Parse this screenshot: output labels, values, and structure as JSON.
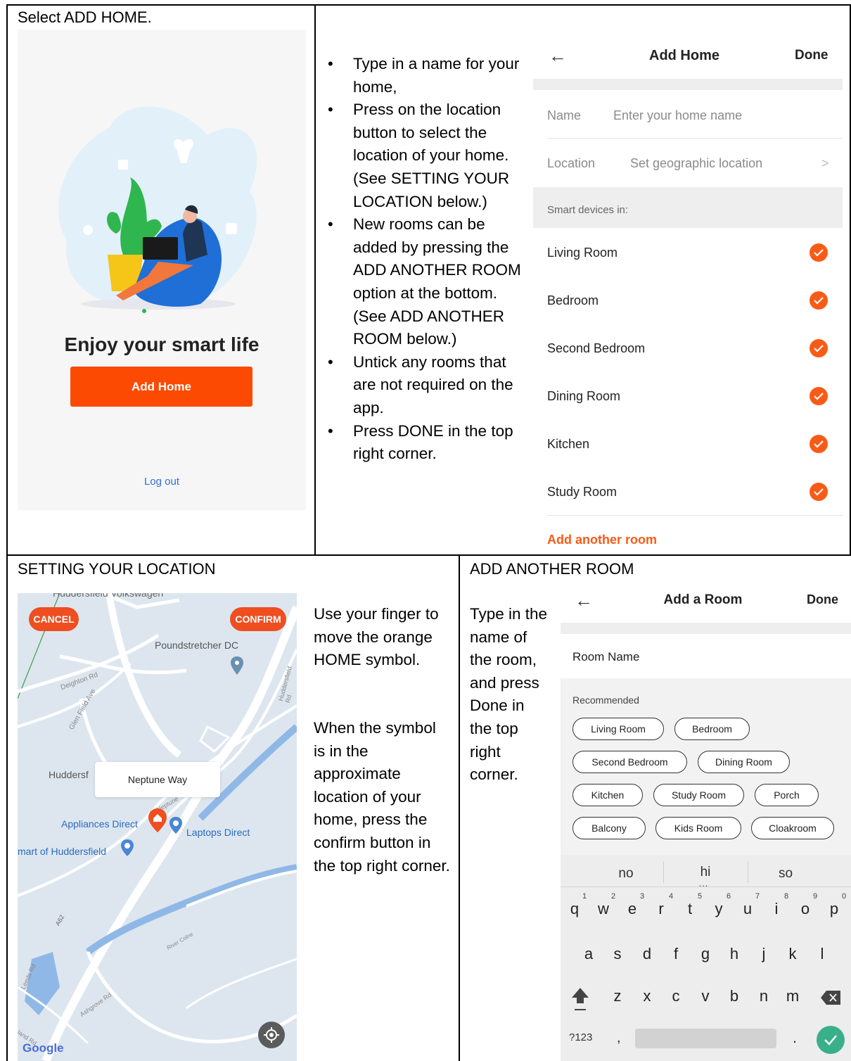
{
  "top_left": {
    "caption": "Select ADD HOME.",
    "headline": "Enjoy your smart life",
    "add_home_button": "Add Home",
    "logout_link": "Log out"
  },
  "top_middle": {
    "bullets": [
      "Type in a name for your home,",
      "Press on the location button to select the location of your home.  (See SETTING YOUR LOCATION below.)",
      "New rooms can be added by pressing the ADD ANOTHER ROOM option at the bottom. (See ADD ANOTHER ROOM below.)",
      "Untick any rooms that are not required on the app.",
      "Press DONE in the top right corner."
    ]
  },
  "add_home": {
    "back_icon": "back-arrow-icon",
    "title": "Add Home",
    "done": "Done",
    "name_label": "Name",
    "name_placeholder": "Enter your home name",
    "location_label": "Location",
    "location_value": "Set geographic location",
    "chevron": ">",
    "section": "Smart devices in:",
    "rooms": [
      "Living Room",
      "Bedroom",
      "Second Bedroom",
      "Dining Room",
      "Kitchen",
      "Study Room"
    ],
    "add_room": "Add another room",
    "accent": "#f95b17"
  },
  "location": {
    "caption": "SETTING YOUR LOCATION",
    "cancel": "CANCEL",
    "confirm": "CONFIRM",
    "top_cut_label": "Huddersfield Volkswagen",
    "poi_poundstretcher": "Poundstretcher DC",
    "road_deighton": "Deighton Rd",
    "road_glen": "Glen Field Ave",
    "huddersf": "Huddersf",
    "popup": "Neptune Way",
    "neptune": "Neptune",
    "appliances": "Appliances Direct",
    "laptops": "Laptops Direct",
    "mart": "mart of Huddersfield",
    "a62": "A62",
    "leeds_rd": "Leeds Rd",
    "ashgrove": "Ashgrove Rd",
    "river": "River Colne",
    "hudd_road": "Huddersfield Rd",
    "land_rd": "land Rd",
    "google": "Google",
    "instructions_1": "Use your finger to move the orange HOME symbol.",
    "instructions_2": "When the symbol is in the approximate location of your home, press the confirm button in the top right corner."
  },
  "add_room": {
    "caption": "ADD ANOTHER ROOM",
    "instructions": "Type in the name of the room, and press Done in the top right corner.",
    "title": "Add a Room",
    "done": "Done",
    "room_name_label": "Room Name",
    "recommended": "Recommended",
    "chips": [
      "Living Room",
      "Bedroom",
      "Second Bedroom",
      "Dining Room",
      "Kitchen",
      "Study Room",
      "Porch",
      "Balcony",
      "Kids Room",
      "Cloakroom"
    ],
    "suggestions": [
      "no",
      "hi",
      "so"
    ],
    "row1": [
      "q",
      "w",
      "e",
      "r",
      "t",
      "y",
      "u",
      "i",
      "o",
      "p"
    ],
    "row1_nums": [
      "1",
      "2",
      "3",
      "4",
      "5",
      "6",
      "7",
      "8",
      "9",
      "0"
    ],
    "row2": [
      "a",
      "s",
      "d",
      "f",
      "g",
      "h",
      "j",
      "k",
      "l"
    ],
    "row3": [
      "z",
      "x",
      "c",
      "v",
      "b",
      "n",
      "m"
    ],
    "sym": "?123",
    "comma": ",",
    "period": "."
  }
}
